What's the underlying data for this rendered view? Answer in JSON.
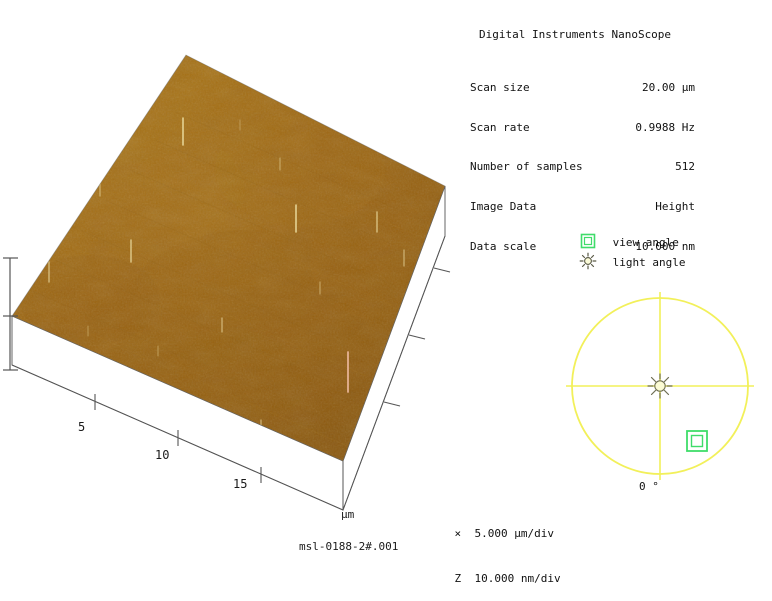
{
  "header": {
    "title": "Digital Instruments NanoScope",
    "params": [
      {
        "label": "Scan size",
        "value": "20.00 µm"
      },
      {
        "label": "Scan rate",
        "value": "0.9988 Hz"
      },
      {
        "label": "Number of samples",
        "value": "512"
      },
      {
        "label": "Image Data",
        "value": "Height"
      },
      {
        "label": "Data scale",
        "value": "10.000 nm"
      }
    ]
  },
  "plot": {
    "x_tick_labels": [
      "5",
      "10",
      "15"
    ],
    "x_unit": "µm",
    "surface_color_base": "#9d6510",
    "surface_color_light": "#c08a22",
    "surface_color_dark": "#7d4d08",
    "side_face_color": "#ffffff",
    "edge_color": "#555555"
  },
  "scale_legend": {
    "rows": [
      {
        "axis": "×",
        "value": "5.000 µm/div"
      },
      {
        "axis": "Z",
        "value": "10.000 nm/div"
      }
    ]
  },
  "caption": {
    "filename": "msl-0188-2#.001"
  },
  "angle_panel": {
    "view_angle_label": "view angle",
    "light_angle_label": "light angle",
    "zero_label": "0 °",
    "dial_color": "#f2f05a",
    "view_marker_color": "#3fdc6a",
    "light_marker_color": "#8a8a5a"
  },
  "chart_data": {
    "type": "heatmap",
    "title": "Digital Instruments NanoScope",
    "rendering": "3d-surface-plot",
    "xlabel": "µm",
    "zlabel": "nm",
    "x_tick_labels": [
      "5",
      "10",
      "15"
    ],
    "x_range_um": [
      0,
      20
    ],
    "x_per_div_um": 5.0,
    "z_per_div_nm": 10.0,
    "scan_size_um": 20.0,
    "scan_rate_hz": 0.9988,
    "number_of_samples": 512,
    "image_data": "Height",
    "data_scale_nm": 10.0,
    "colormap": "amber-gold",
    "notes": "AFM height map rendered as shaded 3D surface block; surface is flat amber-gold with scattered bright vertical spike artifacts."
  }
}
